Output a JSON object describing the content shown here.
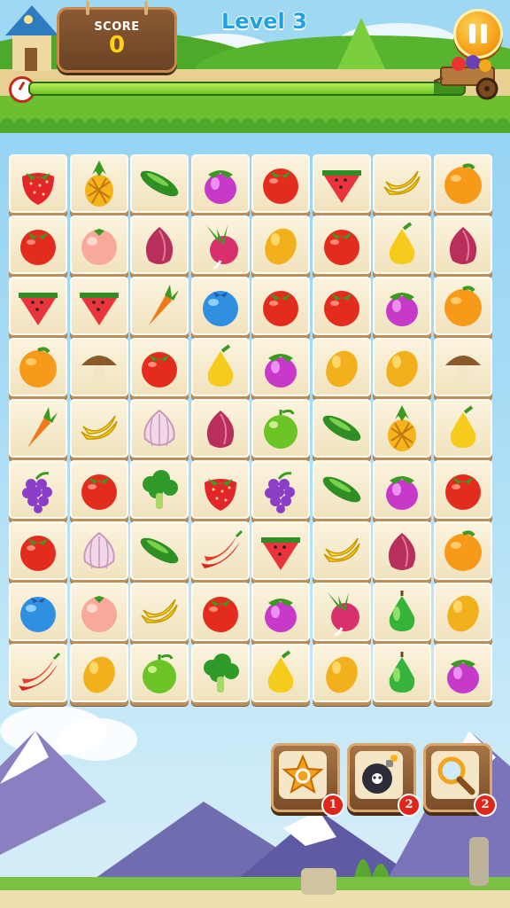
{
  "header": {
    "score_label": "SCORE",
    "score_value": "0",
    "level_label": "Level 3",
    "progress_fraction": 0.93
  },
  "board": {
    "rows": 9,
    "cols": 8,
    "tiles": [
      [
        "strawberry",
        "pineapple",
        "cucumber",
        "eggplant",
        "tomato",
        "watermelon",
        "banana",
        "orange"
      ],
      [
        "tomato",
        "peach",
        "onion",
        "radish",
        "mango",
        "tomato",
        "pear",
        "onion"
      ],
      [
        "watermelon",
        "watermelon",
        "carrot",
        "blueberry",
        "tomato",
        "tomato",
        "eggplant",
        "orange"
      ],
      [
        "orange",
        "mushroom",
        "tomato",
        "pear",
        "eggplant",
        "mango",
        "mango",
        "mushroom"
      ],
      [
        "carrot",
        "banana",
        "garlic",
        "onion",
        "apple",
        "cucumber",
        "pineapple",
        "pear"
      ],
      [
        "grape",
        "tomato",
        "broccoli",
        "strawberry",
        "grape",
        "cucumber",
        "eggplant",
        "tomato"
      ],
      [
        "tomato",
        "garlic",
        "cucumber",
        "chili",
        "watermelon",
        "banana",
        "onion",
        "orange"
      ],
      [
        "blueberry",
        "peach",
        "banana",
        "tomato",
        "eggplant",
        "radish",
        "green-pear",
        "mango"
      ],
      [
        "chili",
        "mango",
        "apple",
        "broccoli",
        "pear",
        "mango",
        "green-pear",
        "eggplant"
      ]
    ]
  },
  "powerups": [
    {
      "name": "shuffle-powerup",
      "icon": "shuffle-star-icon",
      "count": "1"
    },
    {
      "name": "bomb-powerup",
      "icon": "bomb-icon",
      "count": "2"
    },
    {
      "name": "hint-powerup",
      "icon": "magnifier-icon",
      "count": "2"
    }
  ]
}
